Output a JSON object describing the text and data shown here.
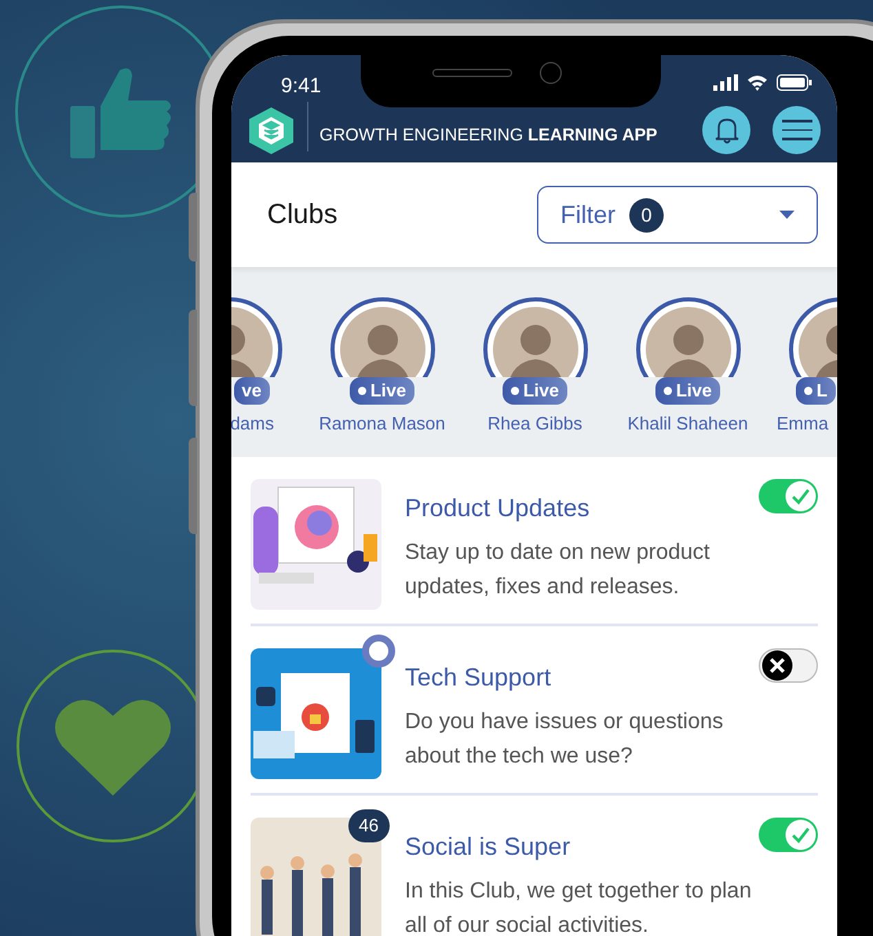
{
  "status_bar": {
    "time": "9:41"
  },
  "app_bar": {
    "title": "GROWTH ENGINEERING **LEARNING APP**"
  },
  "page": {
    "title": "Clubs",
    "filter": {
      "label": "Filter",
      "count": "0"
    }
  },
  "live_members": [
    {
      "name": "dams",
      "badge": "ve"
    },
    {
      "name": "Ramona Mason",
      "badge": "Live"
    },
    {
      "name": "Rhea Gibbs",
      "badge": "Live"
    },
    {
      "name": "Khalil Shaheen",
      "badge": "Live"
    },
    {
      "name": "Emma",
      "badge": "L"
    }
  ],
  "clubs": [
    {
      "title": "Product Updates",
      "description": "Stay up to date on new product updates, fixes and releases.",
      "joined": true
    },
    {
      "title": "Tech Support",
      "description": "Do you have issues or questions about the tech we use?",
      "joined": false,
      "marker": {
        "kind": "ring"
      }
    },
    {
      "title": "Social is Super",
      "description": "In this Club, we get together to plan all of our social activities.",
      "joined": true,
      "marker": {
        "kind": "count",
        "text": "46"
      }
    }
  ]
}
